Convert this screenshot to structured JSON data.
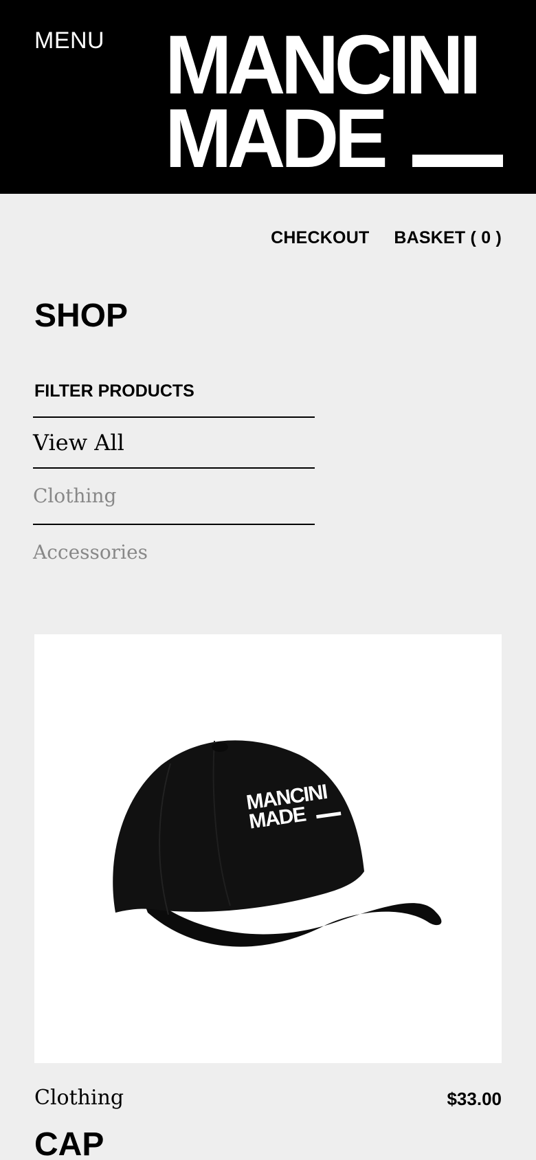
{
  "header": {
    "menu_label": "MENU",
    "logo_line1": "MANCINI",
    "logo_line2": "MADE"
  },
  "nav": {
    "checkout_label": "CHECKOUT",
    "basket_label": "BASKET ( 0 )"
  },
  "shop": {
    "title": "SHOP",
    "filter_title": "FILTER PRODUCTS",
    "filters": [
      {
        "label": "View All",
        "active": true
      },
      {
        "label": "Clothing",
        "active": false
      },
      {
        "label": "Accessories",
        "active": false
      }
    ]
  },
  "products": [
    {
      "category": "Clothing",
      "price": "$33.00",
      "name": "CAP",
      "image_icon": "baseball-cap-image",
      "image_text_line1": "MANCINI",
      "image_text_line2": "MADE"
    }
  ],
  "colors": {
    "header_bg": "#000000",
    "page_bg": "#eeeeee",
    "inactive_filter": "#888888"
  }
}
